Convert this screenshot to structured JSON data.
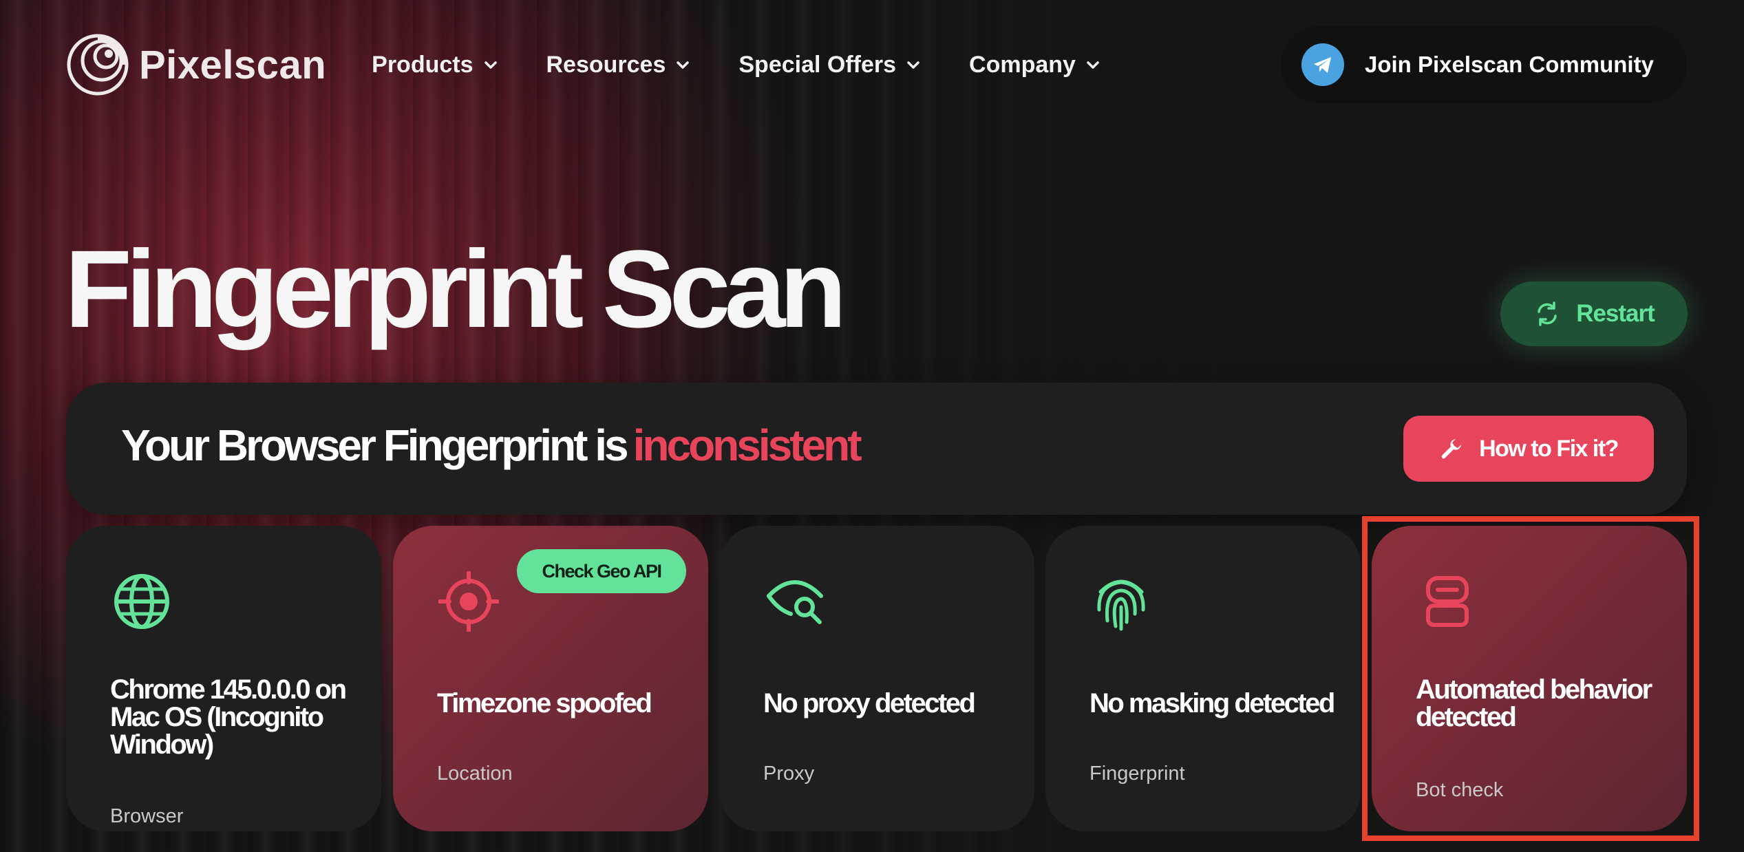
{
  "brand": {
    "name": "Pixelscan"
  },
  "nav": {
    "items": [
      {
        "label": "Products"
      },
      {
        "label": "Resources"
      },
      {
        "label": "Special Offers"
      },
      {
        "label": "Company"
      }
    ],
    "community_label": "Join Pixelscan Community"
  },
  "hero": {
    "title": "Fingerprint Scan",
    "restart_label": "Restart"
  },
  "verdict": {
    "text": "Your Browser Fingerprint is",
    "highlight": "inconsistent",
    "fix_label": "How to Fix it?"
  },
  "cards": [
    {
      "title": "Chrome 145.0.0.0 on Mac OS (Incognito Window)",
      "subtitle": "Browser",
      "icon": "globe-icon",
      "status": "ok"
    },
    {
      "title": "Timezone spoofed",
      "subtitle": "Location",
      "icon": "target-icon",
      "status": "warning",
      "action_label": "Check Geo API"
    },
    {
      "title": "No proxy detected",
      "subtitle": "Proxy",
      "icon": "eye-search-icon",
      "status": "ok"
    },
    {
      "title": "No masking detected",
      "subtitle": "Fingerprint",
      "icon": "fingerprint-icon",
      "status": "ok"
    },
    {
      "title": "Automated behavior detected",
      "subtitle": "Bot check",
      "icon": "robot-icon",
      "status": "warning"
    }
  ],
  "colors": {
    "accent_green": "#63e39a",
    "accent_red": "#e8455c",
    "highlight_frame": "#e6422e",
    "panel": "#1f1f1f"
  }
}
